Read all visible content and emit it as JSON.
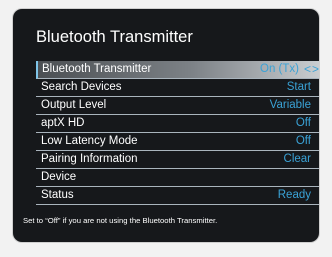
{
  "screen": {
    "title": "Bluetooth Transmitter",
    "help_text": "Set to “Off” if you are not using the Bluetooth Transmitter."
  },
  "menu": {
    "items": [
      {
        "label": "Bluetooth Transmitter",
        "value": "On (Tx)"
      },
      {
        "label": "Search Devices",
        "value": "Start"
      },
      {
        "label": "Output Level",
        "value": "Variable"
      },
      {
        "label": "aptX HD",
        "value": "Off"
      },
      {
        "label": "Low Latency Mode",
        "value": "Off"
      },
      {
        "label": "Pairing Information",
        "value": "Clear"
      },
      {
        "label": "Device",
        "value": ""
      },
      {
        "label": "Status",
        "value": "Ready"
      }
    ],
    "left_arrow": "<",
    "right_arrow": ">"
  },
  "colors": {
    "value_text": "#3aa2d6",
    "background": "#16181b",
    "selected_indicator": "#7ec4e8"
  }
}
